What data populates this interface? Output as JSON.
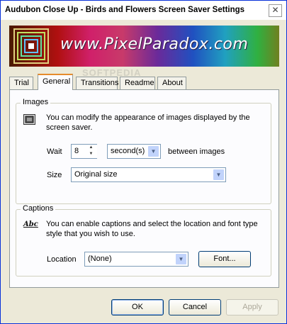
{
  "window": {
    "title": "Audubon Close Up - Birds and Flowers Screen Saver Settings",
    "close_glyph": "✕"
  },
  "banner": {
    "text": "www.PixelParadox.com"
  },
  "watermark": "SOFTPEDIA",
  "tabs": [
    {
      "label": "Trial",
      "active": false
    },
    {
      "label": "General",
      "active": true
    },
    {
      "label": "Transitions",
      "active": false
    },
    {
      "label": "Readme",
      "active": false
    },
    {
      "label": "About",
      "active": false
    }
  ],
  "images_group": {
    "title": "Images",
    "icon": "picture-frame-icon",
    "description": "You can modify the appearance of images displayed by the screen saver.",
    "wait_label": "Wait",
    "wait_value": "8",
    "wait_unit": "second(s)",
    "wait_suffix": "between images",
    "size_label": "Size",
    "size_value": "Original size"
  },
  "captions_group": {
    "title": "Captions",
    "icon": "font-abc-icon",
    "icon_text": "Abc",
    "description": "You can enable captions and select the location and font type style that you wish to use.",
    "location_label": "Location",
    "location_value": "(None)",
    "font_button": "Font..."
  },
  "footer": {
    "ok": "OK",
    "cancel": "Cancel",
    "apply": "Apply"
  },
  "colors": {
    "active_tab_accent": "#e68b2c",
    "frame_blue": "#0831d9",
    "dialog_bg": "#ece9d8"
  }
}
